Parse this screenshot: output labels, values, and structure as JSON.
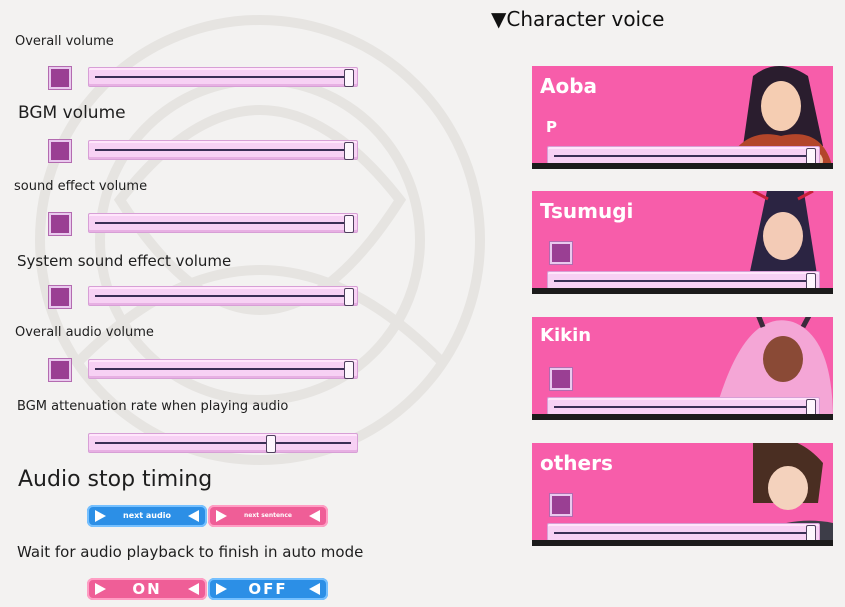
{
  "settings": {
    "overall_volume": {
      "label": "Overall volume",
      "value": 1.0
    },
    "bgm_volume": {
      "label": "BGM volume",
      "value": 1.0
    },
    "sound_effect_volume": {
      "label": "sound effect volume",
      "value": 1.0
    },
    "system_sound_effect_volume": {
      "label": "System sound effect volume",
      "value": 1.0
    },
    "overall_audio_volume": {
      "label": "Overall audio volume",
      "value": 1.0
    },
    "bgm_attenuation": {
      "label": "BGM attenuation rate when playing audio",
      "value": 0.69
    }
  },
  "audio_stop": {
    "title": "Audio stop timing",
    "next_audio": "next audio",
    "next_sentence": "next sentence"
  },
  "auto_mode": {
    "label": "Wait for audio playback to finish in auto mode",
    "on": "ON",
    "off": "OFF"
  },
  "character_voice": {
    "title": "▼Character voice",
    "characters": [
      {
        "name": "Aoba",
        "sub": "P",
        "value": 1.0
      },
      {
        "name": "Tsumugi",
        "value": 1.0
      },
      {
        "name": "Kikin",
        "value": 1.0
      },
      {
        "name": "others",
        "value": 1.0
      }
    ]
  },
  "colors": {
    "mute_box": "#9a3f93",
    "slider_track": "#f7d1f4",
    "card_bg": "#f75daa",
    "button_blue": "#2c8fe6",
    "button_pink": "#ef5e97"
  }
}
